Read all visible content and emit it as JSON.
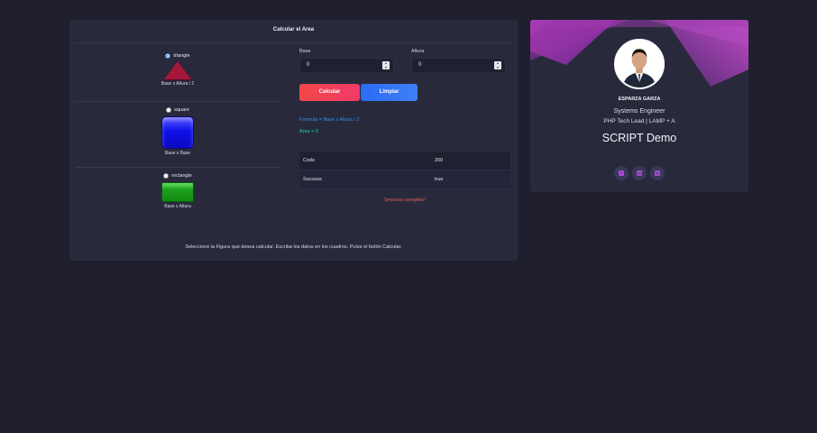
{
  "panel": {
    "title": "Calcular el Area",
    "shapes": [
      {
        "label": "triangle",
        "formula": "Base x Altura / 2",
        "selected": true,
        "color": "#a5173a"
      },
      {
        "label": "square",
        "formula": "Base x Base",
        "selected": false,
        "color": "#1010e8"
      },
      {
        "label": "rectangle",
        "formula": "Base x Altura",
        "selected": false,
        "color": "#1ca11c"
      }
    ],
    "base": {
      "label": "Base",
      "value": "0"
    },
    "altura": {
      "label": "Altura",
      "value": "0"
    },
    "buttons": {
      "calcular": "Calcular",
      "limpiar": "Limpiar"
    },
    "formula_text": "Formula = Base x Altura / 2",
    "area_text": "Area = 0",
    "result": [
      {
        "key": "Code",
        "value": "200"
      },
      {
        "key": "Success",
        "value": "true"
      }
    ],
    "status": "\"proceso completo\"",
    "instructions": "Seleccione la Figura que desea calcular. Escriba los datos en los cuadros. Pulse el botón Calcular."
  },
  "profile": {
    "name": "ESPARZA GARZA",
    "role": "Systems Engineer",
    "subtitle": "PHP Tech Lead | LAMP + A",
    "demo": "SCRIPT Demo",
    "social_icons": [
      "facebook-icon",
      "linkedin-icon",
      "instagram-icon"
    ],
    "accent": "#a74bd6"
  }
}
